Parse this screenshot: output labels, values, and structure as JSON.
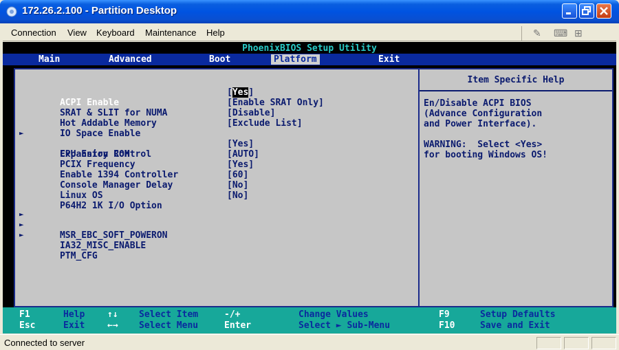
{
  "window": {
    "title": "172.26.2.100 - Partition Desktop"
  },
  "menubar": {
    "items": [
      "Connection",
      "View",
      "Keyboard",
      "Maintenance",
      "Help"
    ]
  },
  "menu_icons": [
    "tool-icon",
    "keyboard-icon",
    "network-icon"
  ],
  "bios": {
    "utility_title": "PhoenixBIOS Setup Utility",
    "tabs": [
      "Main",
      "Advanced",
      "Boot",
      "Platform",
      "Exit"
    ],
    "active_tab": "Platform",
    "items": [
      {
        "label": "ACPI Enable",
        "value_open": "[",
        "value_cursor": "Yes",
        "value_close": "]",
        "selected": true,
        "submenu": false
      },
      {
        "label": "SRAT & SLIT for NUMA",
        "value": "[Enable SRAT Only]",
        "submenu": false
      },
      {
        "label": "Hot Addable Memory",
        "value": "[Disable]",
        "submenu": false
      },
      {
        "label": "IO Space Enable",
        "value": "[Exclude List]",
        "submenu": false
      },
      {
        "label": "Expansion ROM",
        "value": "",
        "submenu": true
      },
      {
        "label": "CPU Entry Control",
        "value": "[Yes]",
        "submenu": false
      },
      {
        "label": "PCIX Frequency",
        "value": "[AUTO]",
        "submenu": false
      },
      {
        "label": "Enable 1394 Controller",
        "value": "[Yes]",
        "submenu": false
      },
      {
        "label": "Console Manager Delay",
        "value": "[60]",
        "submenu": false
      },
      {
        "label": "Linux OS",
        "value": "[No]",
        "submenu": false
      },
      {
        "label": "P64H2 1K I/O Option",
        "value": "[No]",
        "submenu": false
      },
      {
        "label": "MSR_EBC_SOFT_POWERON",
        "value": "",
        "submenu": true
      },
      {
        "label": "IA32_MISC_ENABLE",
        "value": "",
        "submenu": true
      },
      {
        "label": "PTM_CFG",
        "value": "",
        "submenu": true
      }
    ],
    "help": {
      "title": "Item Specific Help",
      "lines": [
        "En/Disable ACPI BIOS",
        "(Advance Configuration",
        "and Power Interface).",
        "",
        "WARNING:  Select <Yes>",
        "for booting Windows OS!"
      ]
    },
    "footer": {
      "row1": [
        {
          "key": "F1",
          "desc": "Help"
        },
        {
          "key": "↑↓",
          "desc": "Select Item"
        },
        {
          "key": "-/+",
          "desc": "Change Values"
        },
        {
          "key": "F9",
          "desc": "Setup Defaults"
        }
      ],
      "row2": [
        {
          "key": "Esc",
          "desc": "Exit"
        },
        {
          "key": "←→",
          "desc": "Select Menu"
        },
        {
          "key": "Enter",
          "desc": "Select ► Sub-Menu"
        },
        {
          "key": "F10",
          "desc": "Save and Exit"
        }
      ]
    }
  },
  "statusbar": {
    "text": "Connected to server"
  }
}
